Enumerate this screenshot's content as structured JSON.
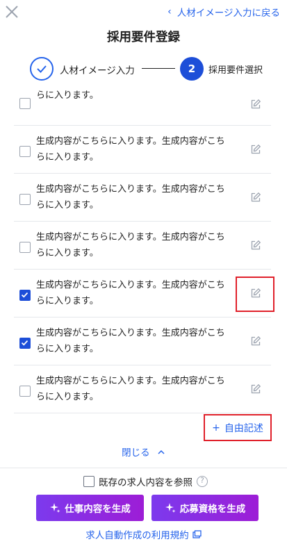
{
  "header": {
    "back_label": "人材イメージ入力に戻る",
    "title": "採用要件登録",
    "close_icon": "close-icon",
    "back_icon": "chevron-left-icon"
  },
  "stepper": {
    "step1_label": "人材イメージ入力",
    "step2_number": "2",
    "step2_label": "採用要件選択",
    "accent": "#1d4ed8"
  },
  "items": [
    {
      "line1": "生成内容がこちらに入ります。生成内容がこち",
      "line2": "らに入ります。",
      "checked": false
    },
    {
      "line1": "生成内容がこちらに入ります。生成内容がこち",
      "line2": "らに入ります。",
      "checked": false
    },
    {
      "line1": "生成内容がこちらに入ります。生成内容がこち",
      "line2": "らに入ります。",
      "checked": false
    },
    {
      "line1": "生成内容がこちらに入ります。生成内容がこち",
      "line2": "らに入ります。",
      "checked": false
    },
    {
      "line1": "生成内容がこちらに入ります。生成内容がこち",
      "line2": "らに入ります。",
      "checked": true
    },
    {
      "line1": "生成内容がこちらに入ります。生成内容がこち",
      "line2": "らに入ります。",
      "checked": true
    },
    {
      "line1": "生成内容がこちらに入ります。生成内容がこち",
      "line2": "らに入ります。",
      "checked": false
    }
  ],
  "free_write": {
    "plus": "+",
    "label": "自由記述"
  },
  "close_label": "閉じる",
  "existing_ref": {
    "label": "既存の求人内容を参照",
    "help": "?"
  },
  "buttons": {
    "generate_job": "仕事内容を生成",
    "generate_qual": "応募資格を生成"
  },
  "terms_label": "求人自動作成の利用規約",
  "colors": {
    "link": "#2563eb",
    "highlight": "#e0202a",
    "button_gradient": [
      "#7c3aed",
      "#9d1dd6"
    ]
  }
}
